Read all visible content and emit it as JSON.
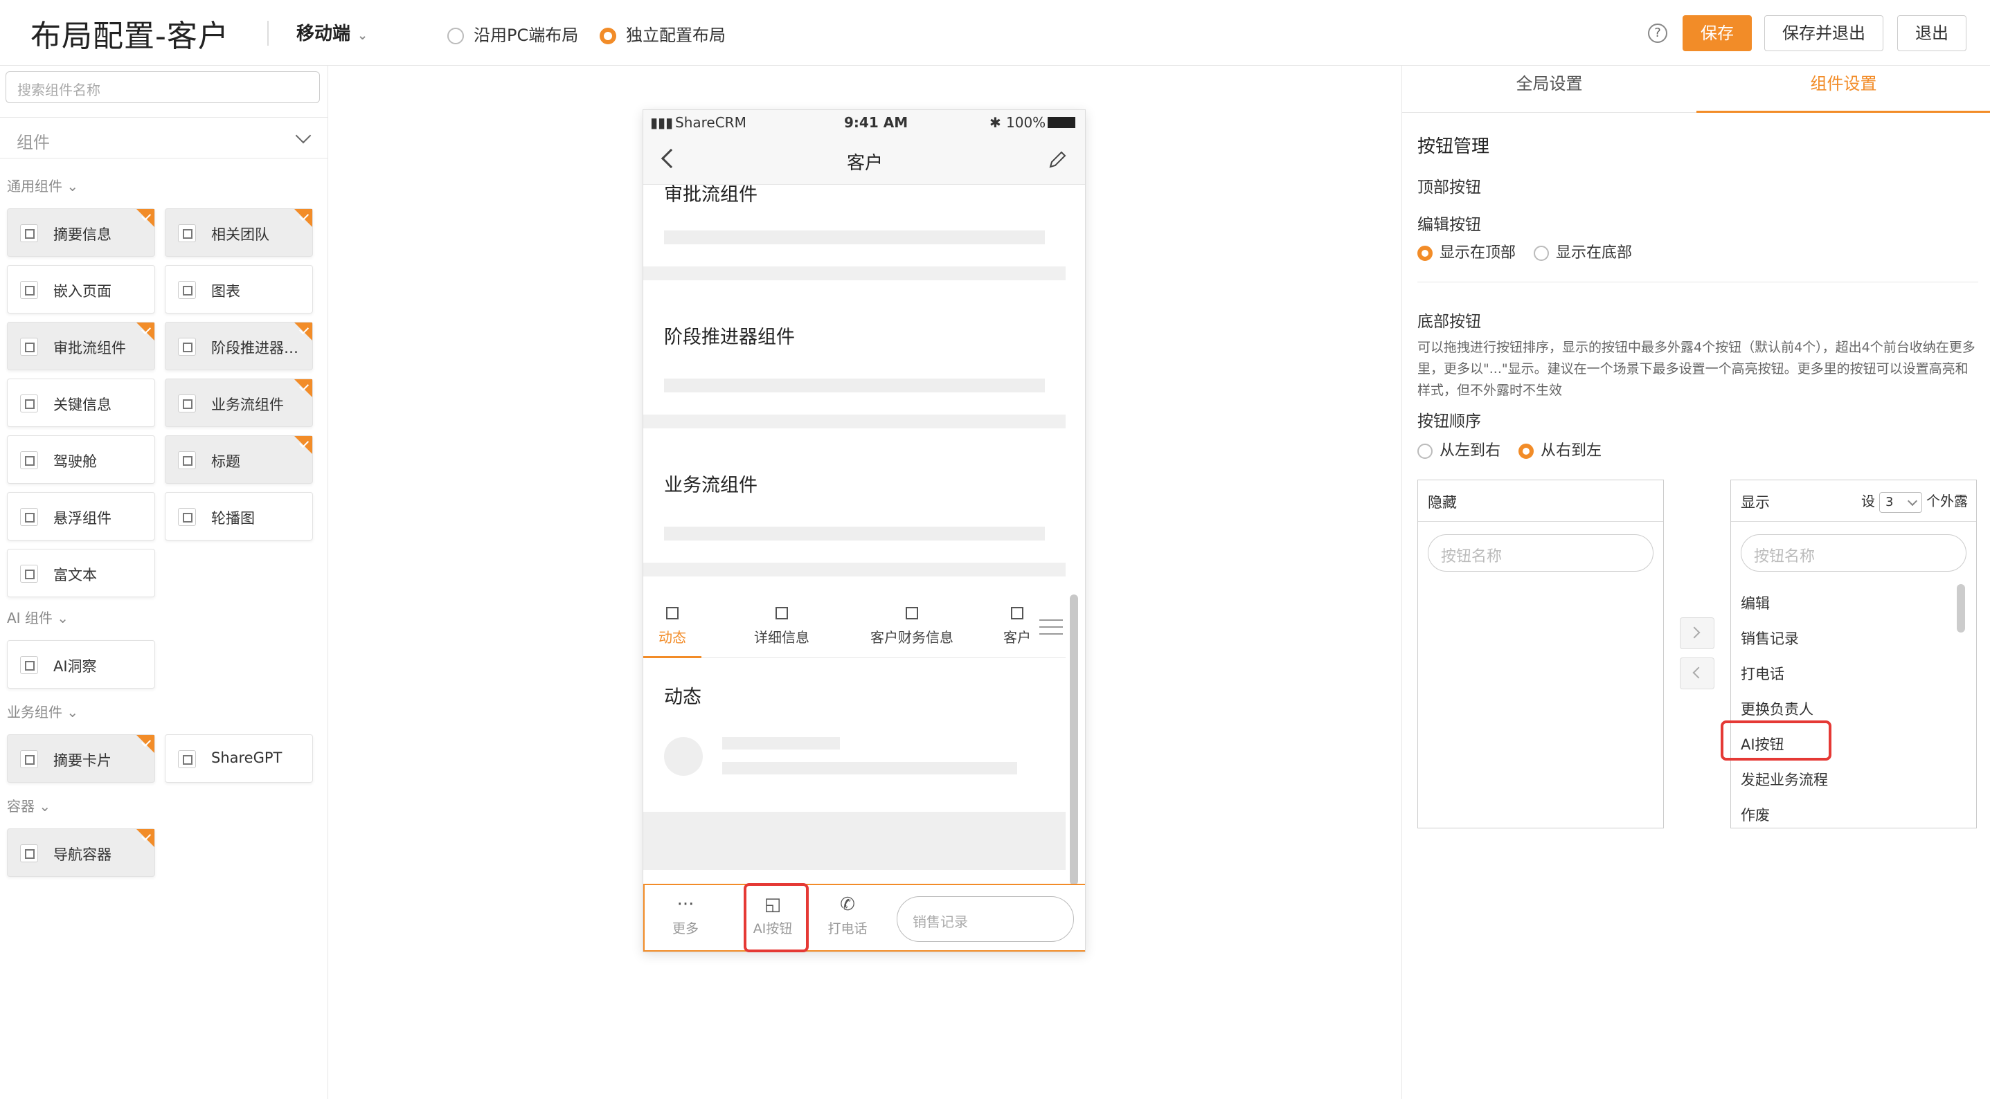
{
  "header": {
    "title": "布局配置-客户",
    "device": "移动端",
    "layout_options": [
      "沿用PC端布局",
      "独立配置布局"
    ],
    "layout_selected": 1,
    "save": "保存",
    "save_exit": "保存并退出",
    "exit": "退出",
    "accent_color": "#f28c28"
  },
  "left": {
    "search_placeholder": "搜索组件名称",
    "category": "组件",
    "sections": [
      {
        "title": "通用组件",
        "items": [
          {
            "label": "摘要信息",
            "used": true
          },
          {
            "label": "相关团队",
            "used": true
          },
          {
            "label": "嵌入页面",
            "used": false
          },
          {
            "label": "图表",
            "used": false
          },
          {
            "label": "审批流组件",
            "used": true
          },
          {
            "label": "阶段推进器…",
            "used": true
          },
          {
            "label": "关键信息",
            "used": false
          },
          {
            "label": "业务流组件",
            "used": true
          },
          {
            "label": "驾驶舱",
            "used": false
          },
          {
            "label": "标题",
            "used": true
          },
          {
            "label": "悬浮组件",
            "used": false
          },
          {
            "label": "轮播图",
            "used": false
          },
          {
            "label": "富文本",
            "used": false
          }
        ]
      },
      {
        "title": "AI 组件",
        "items": [
          {
            "label": "AI洞察",
            "used": false
          }
        ]
      },
      {
        "title": "业务组件",
        "items": [
          {
            "label": "摘要卡片",
            "used": true
          },
          {
            "label": "ShareGPT",
            "used": false
          }
        ]
      },
      {
        "title": "容器",
        "items": [
          {
            "label": "导航容器",
            "used": true
          }
        ]
      }
    ]
  },
  "phone": {
    "carrier": "ShareCRM",
    "time": "9:41 AM",
    "battery": "100%",
    "nav_title": "客户",
    "blocks": [
      "审批流组件",
      "阶段推进器组件",
      "业务流组件"
    ],
    "tabs": [
      "动态",
      "详细信息",
      "客户财务信息",
      "客户"
    ],
    "tab_active": 0,
    "section_title": "动态",
    "bottom": {
      "more": "更多",
      "ai": "AI按钮",
      "call": "打电话",
      "sales": "销售记录",
      "more_glyph": "···"
    }
  },
  "right": {
    "tabs": [
      "全局设置",
      "组件设置"
    ],
    "tab_active": 1,
    "title": "按钮管理",
    "top_buttons": "顶部按钮",
    "edit_button": "编辑按钮",
    "edit_options": [
      "显示在顶部",
      "显示在底部"
    ],
    "bottom_buttons": "底部按钮",
    "desc": "可以拖拽进行按钮排序，显示的按钮中最多外露4个按钮（默认前4个），超出4个前台收纳在更多里，更多以\"...\"显示。建议在一个场景下最多设置一个高亮按钮。更多里的按钮可以设置高亮和样式，但不外露时不生效",
    "order_label": "按钮顺序",
    "order_options": [
      "从左到右",
      "从右到左"
    ],
    "hidden_title": "隐藏",
    "shown_title": "显示",
    "set_label": "设",
    "set_value": "3",
    "exposed_label": "个外露",
    "search_placeholder": "按钮名称",
    "shown_items": [
      "编辑",
      "销售记录",
      "打电话",
      "更换负责人",
      "AI按钮",
      "发起业务流程",
      "作废"
    ]
  }
}
